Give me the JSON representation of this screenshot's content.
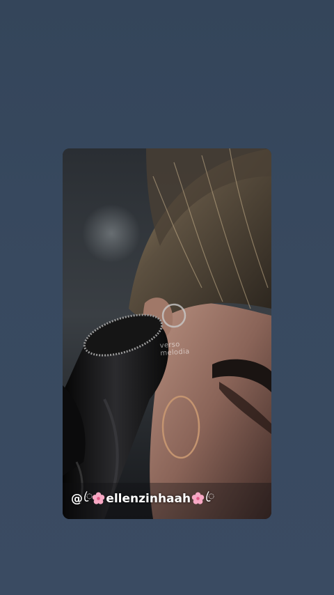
{
  "story": {
    "watermark_line1": "verso",
    "watermark_line2": "melodia",
    "handle": {
      "prefix": "@",
      "ornament": "ꦿ",
      "name": "ellenzinhaah"
    }
  },
  "colors": {
    "background": "#38495f",
    "flower": "#f7a8c4"
  },
  "icons": [
    "flower-icon"
  ]
}
